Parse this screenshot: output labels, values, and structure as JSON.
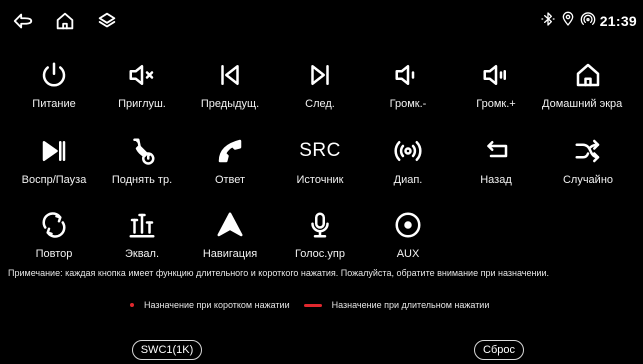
{
  "status": {
    "clock": "21:39",
    "left_icons": [
      "back-icon",
      "home-icon",
      "layers-icon"
    ],
    "right_icons": [
      "bluetooth-icon",
      "location-icon",
      "hotspot-icon"
    ]
  },
  "buttons": [
    {
      "label": "Питание",
      "icon": "power-icon"
    },
    {
      "label": "Приглуш.",
      "icon": "mute-icon"
    },
    {
      "label": "Предыдущ.",
      "icon": "prev-track-icon"
    },
    {
      "label": "След.",
      "icon": "next-track-icon"
    },
    {
      "label": "Громк.-",
      "icon": "volume-down-icon"
    },
    {
      "label": "Громк.+",
      "icon": "volume-up-icon"
    },
    {
      "label": "Домашний экра",
      "icon": "home-screen-icon"
    },
    {
      "label": "Воспр/Пауза",
      "icon": "play-pause-icon"
    },
    {
      "label": "Поднять тр.",
      "icon": "pickup-phone-icon"
    },
    {
      "label": "Ответ",
      "icon": "answer-phone-icon"
    },
    {
      "label": "Источник",
      "icon": "source-icon",
      "text": "SRC"
    },
    {
      "label": "Диап.",
      "icon": "band-icon"
    },
    {
      "label": "Назад",
      "icon": "return-icon"
    },
    {
      "label": "Случайно",
      "icon": "shuffle-icon"
    },
    {
      "label": "Повтор",
      "icon": "repeat-icon"
    },
    {
      "label": "Эквал.",
      "icon": "equalizer-icon"
    },
    {
      "label": "Навигация",
      "icon": "navigation-icon"
    },
    {
      "label": "Голос.упр",
      "icon": "voice-icon"
    },
    {
      "label": "AUX",
      "icon": "aux-icon"
    }
  ],
  "note": "Примечание: каждая кнопка имеет функцию длительного и короткого нажатия. Пожалуйста, обратите внимание при назначении.",
  "legend": {
    "short": "Назначение при коротком нажатии",
    "long": "Назначение при длительном нажатии",
    "color": "#e0282e"
  },
  "footer": {
    "swc_label": "SWC1(1K)",
    "reset_label": "Сброс"
  }
}
